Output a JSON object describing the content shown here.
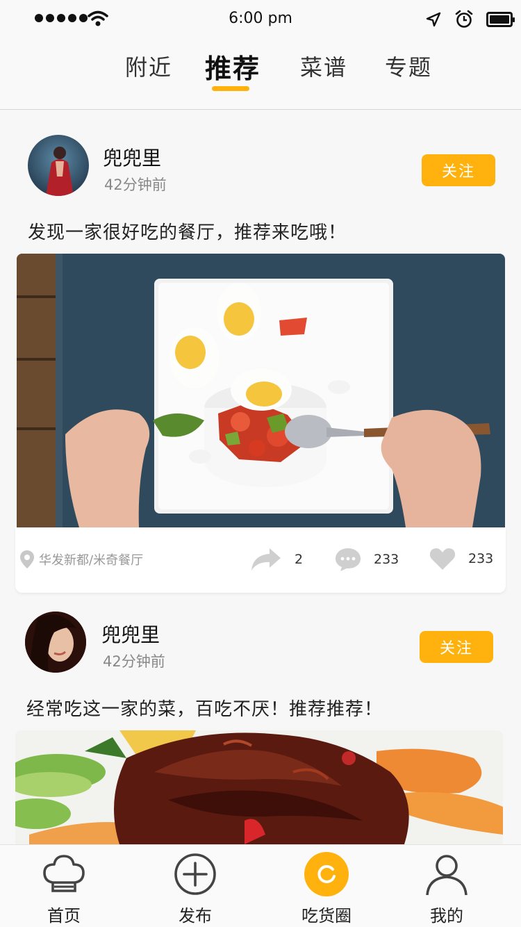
{
  "status_bar": {
    "time": "6:00 pm"
  },
  "tabs": {
    "nearby": "附近",
    "recommended": "推荐",
    "recipes": "菜谱",
    "topics": "专题"
  },
  "posts": [
    {
      "username": "兜兜里",
      "time_ago": "42分钟前",
      "follow_label": "关注",
      "text": "发现一家很好吃的餐厅，推荐来吃哦！",
      "location": "华发新都/米奇餐厅",
      "shares": "2",
      "comments": "233",
      "likes": "233"
    },
    {
      "username": "兜兜里",
      "time_ago": "42分钟前",
      "follow_label": "关注",
      "text": "经常吃这一家的菜，百吃不厌！推荐推荐！"
    }
  ],
  "bottom_nav": {
    "home": "首页",
    "publish": "发布",
    "foodie_circle": "吃货圈",
    "mine": "我的"
  },
  "colors": {
    "accent": "#ffb20e",
    "text_primary": "#222222",
    "text_secondary": "#888888"
  },
  "icons": [
    "signal-dots-icon",
    "wifi-icon",
    "location-arrow-icon",
    "alarm-clock-icon",
    "battery-icon",
    "map-pin-icon",
    "share-icon",
    "comment-icon",
    "heart-icon",
    "chef-hat-icon",
    "plus-circle-icon",
    "refresh-circle-icon",
    "user-icon"
  ]
}
